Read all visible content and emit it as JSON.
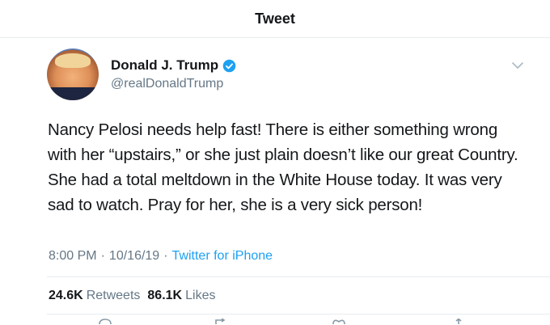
{
  "header": {
    "title": "Tweet"
  },
  "author": {
    "name": "Donald J. Trump",
    "handle": "@realDonaldTrump",
    "verified": true
  },
  "tweet": {
    "text": "Nancy Pelosi needs help fast! There is either something wrong with her “upstairs,” or she just plain doesn’t like our great Country. She had a total meltdown in the White House today. It was very sad to watch. Pray for her, she is a very sick person!",
    "time": "8:00 PM",
    "date": "10/16/19",
    "separator": "·",
    "source": "Twitter for iPhone"
  },
  "stats": {
    "retweets_count": "24.6K",
    "retweets_label": "Retweets",
    "likes_count": "86.1K",
    "likes_label": "Likes"
  },
  "icons": {
    "verified": "verified-badge-icon",
    "chevron": "chevron-down-icon",
    "actions": [
      "reply-icon",
      "retweet-icon",
      "like-icon",
      "share-icon"
    ]
  },
  "colors": {
    "accent": "#1da1f2",
    "secondary_text": "#657786",
    "divider": "#e6ecf0"
  }
}
